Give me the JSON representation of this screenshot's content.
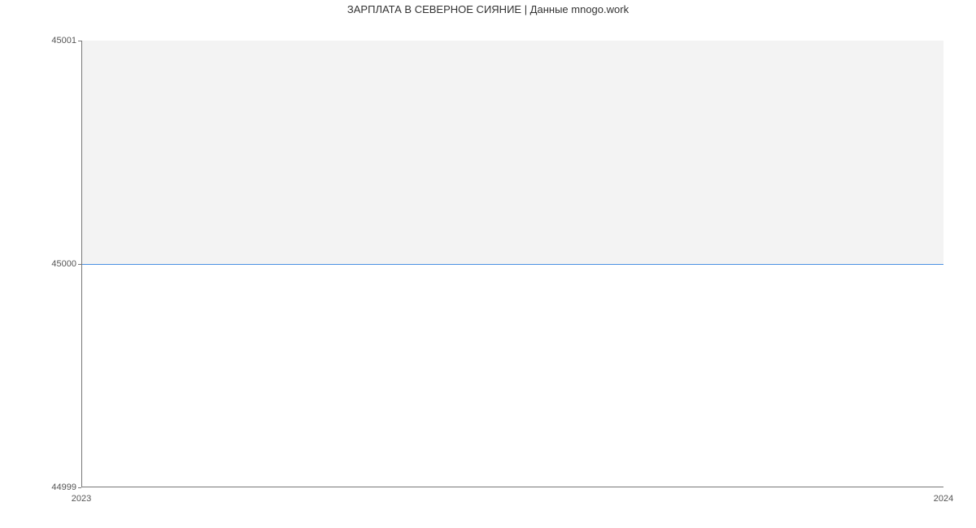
{
  "chart_data": {
    "type": "line",
    "title": "ЗАРПЛАТА В СЕВЕРНОЕ СИЯНИЕ | Данные mnogo.work",
    "xlabel": "",
    "ylabel": "",
    "x": [
      2023,
      2024
    ],
    "values": [
      45000,
      45000
    ],
    "ylim": [
      44999,
      45001
    ],
    "xlim": [
      2023,
      2024
    ],
    "y_ticks": [
      "44999",
      "45000",
      "45001"
    ],
    "x_ticks": [
      "2023",
      "2024"
    ],
    "line_color": "#4a90e2",
    "fill_color": "#f3f3f3"
  }
}
